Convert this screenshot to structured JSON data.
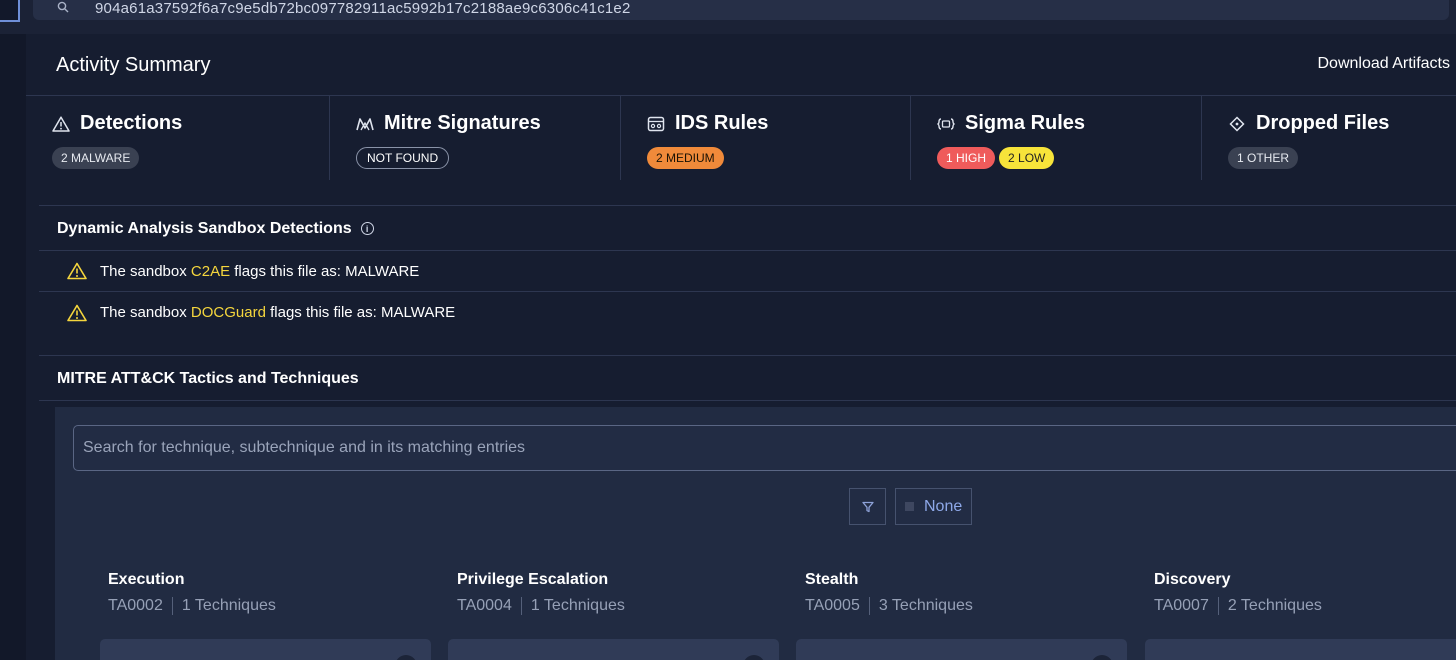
{
  "header": {
    "hash_value": "904a61a37592f6a7c9e5db72bc097782911ac5992b17c2188ae9c6306c41c1e2"
  },
  "activity": {
    "title": "Activity Summary",
    "download_label": "Download Artifacts"
  },
  "summary_cards": [
    {
      "title": "Detections",
      "icon": "warning-triangle-icon",
      "badges": [
        "2 MALWARE"
      ]
    },
    {
      "title": "Mitre Signatures",
      "icon": "mitre-icon",
      "badges": [
        "NOT FOUND"
      ]
    },
    {
      "title": "IDS Rules",
      "icon": "ids-icon",
      "badges": [
        "2 MEDIUM"
      ]
    },
    {
      "title": "Sigma Rules",
      "icon": "sigma-icon",
      "badges": [
        "1 HIGH",
        "2 LOW"
      ]
    },
    {
      "title": "Dropped Files",
      "icon": "diamond-icon",
      "badges": [
        "1 OTHER"
      ]
    }
  ],
  "sandbox": {
    "title": "Dynamic Analysis Sandbox Detections",
    "rows": [
      {
        "prefix": "The sandbox ",
        "name": "C2AE",
        "suffix": " flags this file as: MALWARE"
      },
      {
        "prefix": "The sandbox ",
        "name": "DOCGuard",
        "suffix": " flags this file as: MALWARE"
      }
    ]
  },
  "mitre": {
    "title": "MITRE ATT&CK Tactics and Techniques",
    "search_placeholder": "Search for technique, subtechnique and in its matching entries",
    "filter_none_label": "None",
    "tactics": [
      {
        "name": "Execution",
        "id": "TA0002",
        "techniques": "1 Techniques"
      },
      {
        "name": "Privilege Escalation",
        "id": "TA0004",
        "techniques": "1 Techniques"
      },
      {
        "name": "Stealth",
        "id": "TA0005",
        "techniques": "3 Techniques"
      },
      {
        "name": "Discovery",
        "id": "TA0007",
        "techniques": "2 Techniques"
      }
    ]
  },
  "colors": {
    "accent_highlight": "#f5d63d",
    "badge_medium": "#f08a3a",
    "badge_high": "#ef5b5b",
    "badge_low": "#f7e43a"
  }
}
